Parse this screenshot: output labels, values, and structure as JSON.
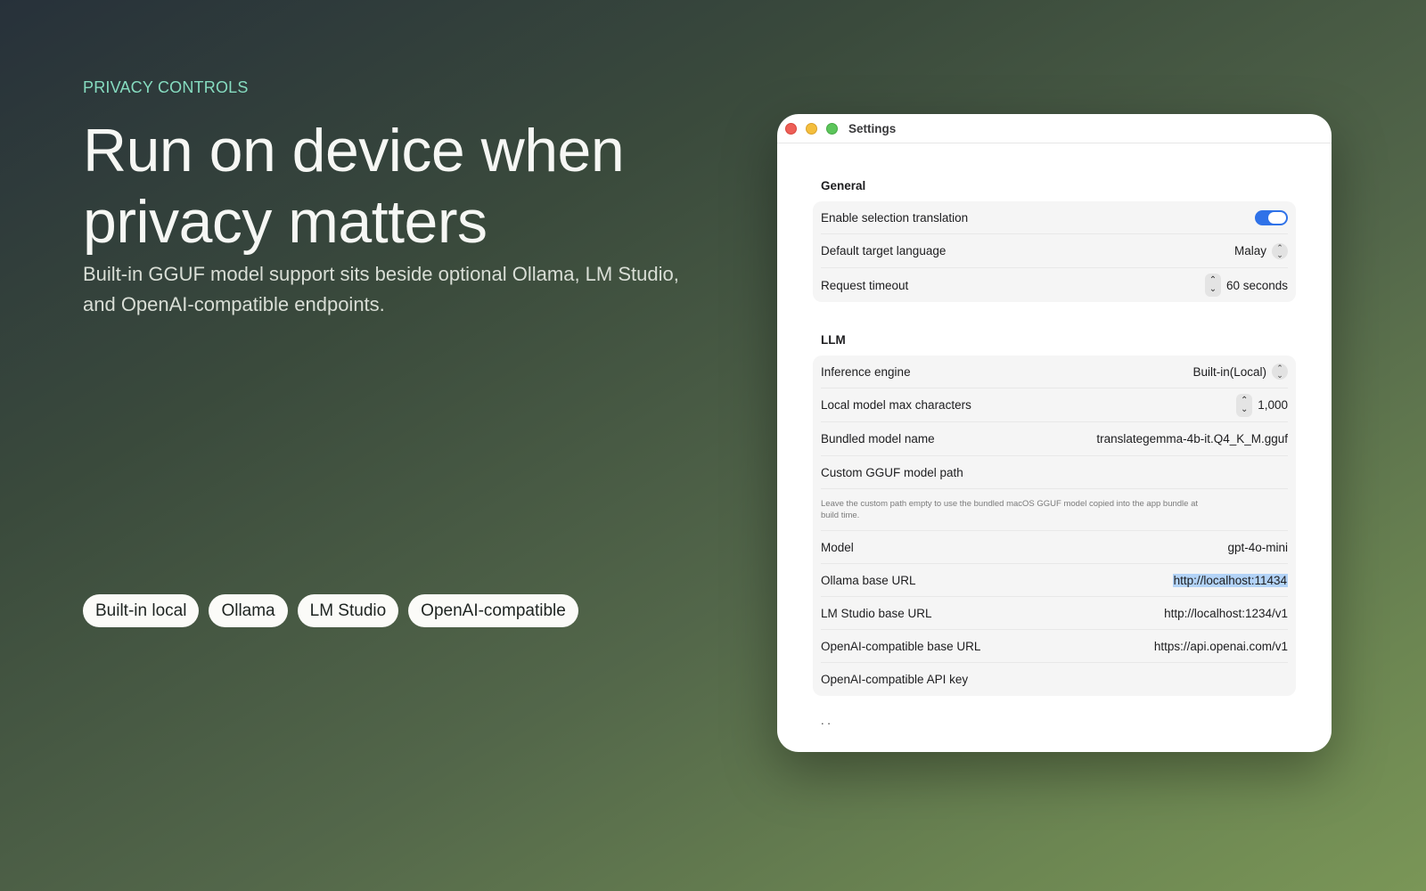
{
  "hero": {
    "eyebrow": "PRIVACY CONTROLS",
    "headline_line1": "Run on device when",
    "headline_line2": "privacy matters",
    "subhead_line1": "Built-in GGUF model support sits beside optional Ollama, LM Studio,",
    "subhead_line2": "and OpenAI-compatible endpoints."
  },
  "chips": [
    "Built-in local",
    "Ollama",
    "LM Studio",
    "OpenAI-compatible"
  ],
  "window": {
    "title": "Settings",
    "general": {
      "title": "General",
      "enable_selection_label": "Enable selection translation",
      "enable_selection_on": true,
      "target_language_label": "Default target language",
      "target_language_value": "Malay",
      "timeout_label": "Request timeout",
      "timeout_value": "60 seconds"
    },
    "llm": {
      "title": "LLM",
      "engine_label": "Inference engine",
      "engine_value": "Built-in(Local)",
      "max_chars_label": "Local model max characters",
      "max_chars_value": "1,000",
      "bundled_label": "Bundled model name",
      "bundled_value": "translategemma-4b-it.Q4_K_M.gguf",
      "custom_path_label": "Custom GGUF model path",
      "note_line1": "Leave the custom path empty to use the bundled macOS GGUF model copied into the app bundle at",
      "note_line2": "build time.",
      "model_label": "Model",
      "model_value": "gpt-4o-mini",
      "ollama_label": "Ollama base URL",
      "ollama_value": "http://localhost:11434",
      "lmstudio_label": "LM Studio base URL",
      "lmstudio_value": "http://localhost:1234/v1",
      "openai_url_label": "OpenAI-compatible base URL",
      "openai_url_value": "https://api.openai.com/v1",
      "openai_key_label": "OpenAI-compatible API key"
    },
    "more_indicator": ". ."
  },
  "colors": {
    "accent": "#2f72e8",
    "eyebrow": "#86dcc0",
    "selection_highlight": "#b3d3f7"
  }
}
